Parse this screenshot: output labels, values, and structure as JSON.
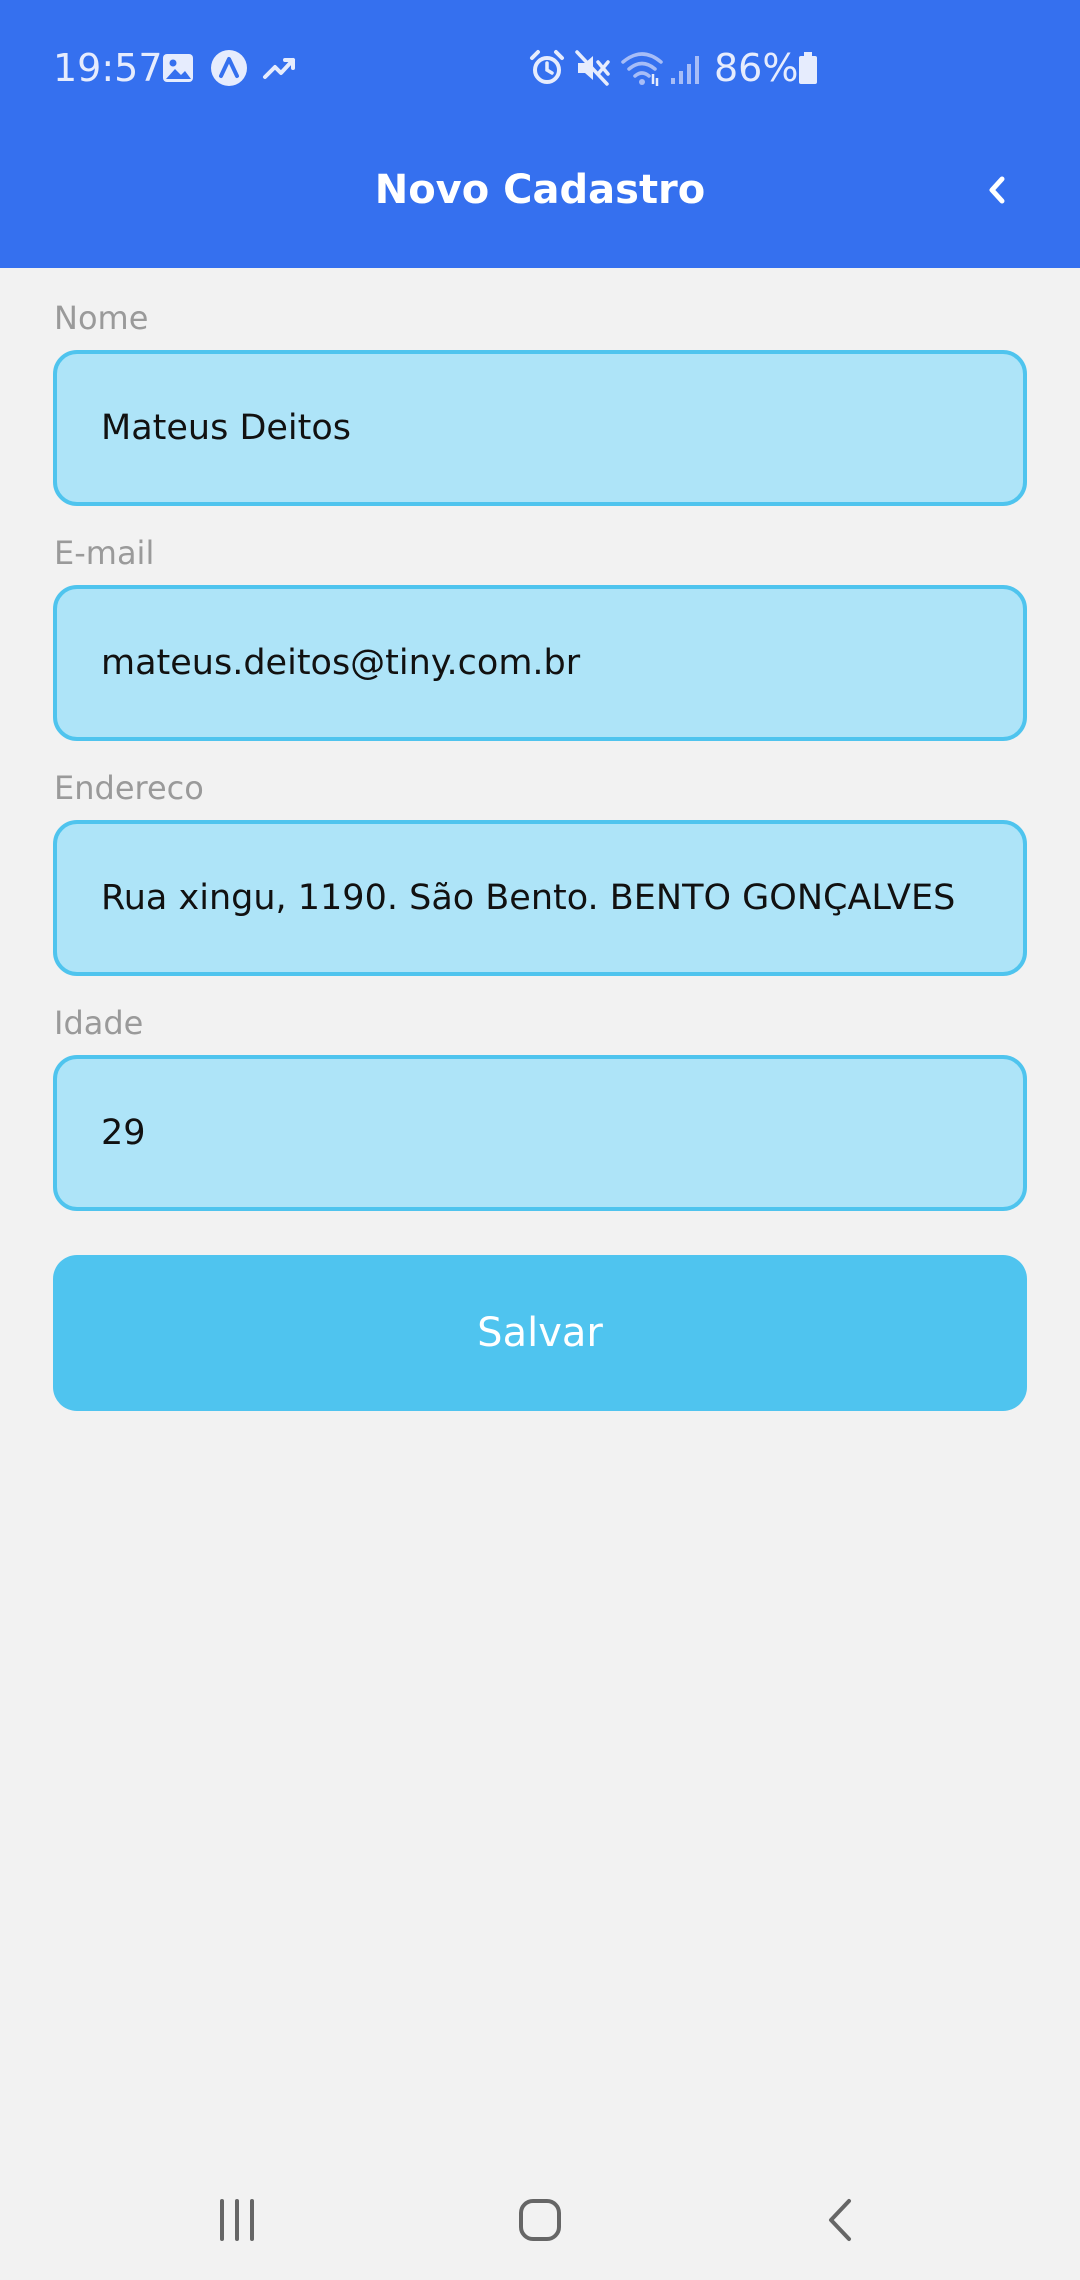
{
  "status_bar": {
    "time": "19:57",
    "battery_percent": "86%",
    "left_icons": [
      "image-icon",
      "app-notification-icon",
      "trending-icon"
    ],
    "right_icons": [
      "alarm-icon",
      "mute-icon",
      "wifi-icon",
      "signal-icon",
      "battery-icon"
    ]
  },
  "header": {
    "title": "Novo Cadastro",
    "back_icon": "chevron-left-icon",
    "background_color": "#3570ef"
  },
  "form": {
    "fields": [
      {
        "label": "Nome",
        "value": "Mateus Deitos"
      },
      {
        "label": "E-mail",
        "value": "mateus.deitos@tiny.com.br"
      },
      {
        "label": "Endereco",
        "value": "Rua xingu, 1190. São Bento. BENTO GONÇALVES"
      },
      {
        "label": "Idade",
        "value": "29"
      }
    ],
    "input_fill_color": "#aee4f8",
    "input_border_color": "#4fc4ee",
    "save_label": "Salvar",
    "save_button_color": "#4fc4ef"
  },
  "nav_bar": {
    "buttons": [
      "recent-apps-icon",
      "home-icon",
      "back-icon"
    ]
  }
}
